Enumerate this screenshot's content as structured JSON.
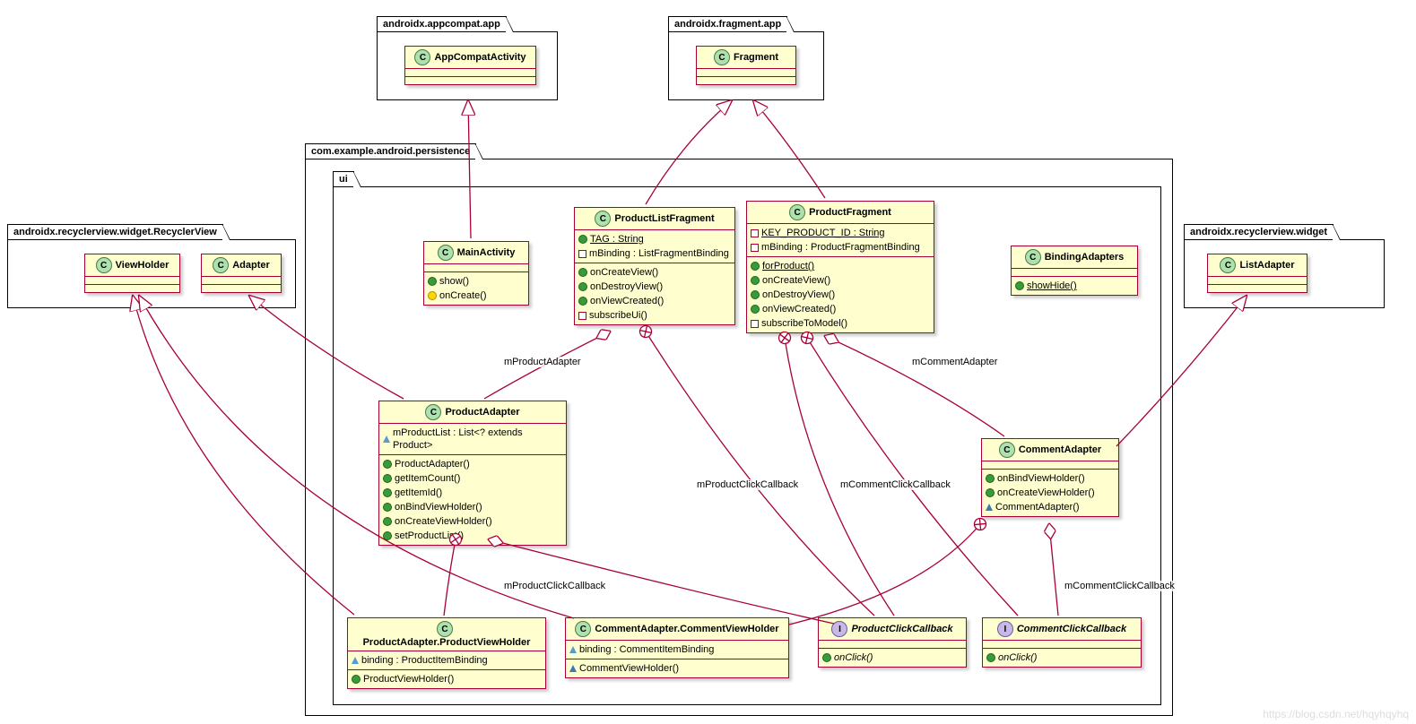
{
  "packages": {
    "appcompat": "androidx.appcompat.app",
    "fragment_app": "androidx.fragment.app",
    "recycler_rv": "androidx.recyclerview.widget.RecyclerView",
    "recycler_widget": "androidx.recyclerview.widget",
    "persistence": "com.example.android.persistence",
    "ui": "ui"
  },
  "classes": {
    "AppCompatActivity": {
      "name": "AppCompatActivity",
      "type": "C"
    },
    "Fragment": {
      "name": "Fragment",
      "type": "C"
    },
    "ViewHolder": {
      "name": "ViewHolder",
      "type": "C"
    },
    "Adapter": {
      "name": "Adapter",
      "type": "C"
    },
    "ListAdapter": {
      "name": "ListAdapter",
      "type": "C"
    },
    "MainActivity": {
      "name": "MainActivity",
      "type": "C",
      "ops": [
        "show()",
        "onCreate()"
      ],
      "vis": [
        "pub",
        "prot"
      ]
    },
    "ProductListFragment": {
      "name": "ProductListFragment",
      "type": "C",
      "attrs": [
        {
          "v": "pub",
          "t": "TAG : String",
          "u": true
        },
        {
          "v": "priv",
          "t": "mBinding : ListFragmentBinding"
        }
      ],
      "ops": [
        {
          "v": "pub",
          "t": "onCreateView()"
        },
        {
          "v": "pub",
          "t": "onDestroyView()"
        },
        {
          "v": "pub",
          "t": "onViewCreated()"
        },
        {
          "v": "priv",
          "t": "subscribeUi()"
        }
      ]
    },
    "ProductFragment": {
      "name": "ProductFragment",
      "type": "C",
      "attrs": [
        {
          "v": "priv",
          "t": "KEY_PRODUCT_ID : String",
          "u": true
        },
        {
          "v": "priv",
          "t": "mBinding : ProductFragmentBinding"
        }
      ],
      "ops": [
        {
          "v": "pub",
          "t": "forProduct()",
          "u": true
        },
        {
          "v": "pub",
          "t": "onCreateView()"
        },
        {
          "v": "pub",
          "t": "onDestroyView()"
        },
        {
          "v": "pub",
          "t": "onViewCreated()"
        },
        {
          "v": "priv",
          "t": "subscribeToModel()"
        }
      ]
    },
    "BindingAdapters": {
      "name": "BindingAdapters",
      "type": "C",
      "ops": [
        {
          "v": "pub",
          "t": "showHide()",
          "u": true
        }
      ]
    },
    "ProductAdapter": {
      "name": "ProductAdapter",
      "type": "C",
      "attrs": [
        {
          "v": "pkg",
          "t": "mProductList : List<? extends Product>"
        }
      ],
      "ops": [
        {
          "v": "pub",
          "t": "ProductAdapter()"
        },
        {
          "v": "pub",
          "t": "getItemCount()"
        },
        {
          "v": "pub",
          "t": "getItemId()"
        },
        {
          "v": "pub",
          "t": "onBindViewHolder()"
        },
        {
          "v": "pub",
          "t": "onCreateViewHolder()"
        },
        {
          "v": "pub",
          "t": "setProductList()"
        }
      ]
    },
    "CommentAdapter": {
      "name": "CommentAdapter",
      "type": "C",
      "ops": [
        {
          "v": "pub",
          "t": "onBindViewHolder()"
        },
        {
          "v": "pub",
          "t": "onCreateViewHolder()"
        },
        {
          "v": "pkgf",
          "t": "CommentAdapter()"
        }
      ]
    },
    "ProductAdapterProductViewHolder": {
      "name": "ProductAdapter.ProductViewHolder",
      "type": "C",
      "attrs": [
        {
          "v": "pkg",
          "t": "binding : ProductItemBinding"
        }
      ],
      "ops": [
        {
          "v": "pub",
          "t": "ProductViewHolder()"
        }
      ]
    },
    "CommentAdapterCommentViewHolder": {
      "name": "CommentAdapter.CommentViewHolder",
      "type": "C",
      "attrs": [
        {
          "v": "pkg",
          "t": "binding : CommentItemBinding"
        }
      ],
      "ops": [
        {
          "v": "pkgf",
          "t": "CommentViewHolder()"
        }
      ]
    },
    "ProductClickCallback": {
      "name": "ProductClickCallback",
      "type": "I",
      "ops": [
        {
          "v": "pub",
          "t": "onClick()",
          "i": true
        }
      ]
    },
    "CommentClickCallback": {
      "name": "CommentClickCallback",
      "type": "I",
      "ops": [
        {
          "v": "pub",
          "t": "onClick()",
          "i": true
        }
      ]
    }
  },
  "labels": {
    "mProductAdapter": "mProductAdapter",
    "mCommentAdapter": "mCommentAdapter",
    "mProductClickCallback": "mProductClickCallback",
    "mCommentClickCallback": "mCommentClickCallback"
  },
  "watermark": "https://blog.csdn.net/hqyhqyhq"
}
